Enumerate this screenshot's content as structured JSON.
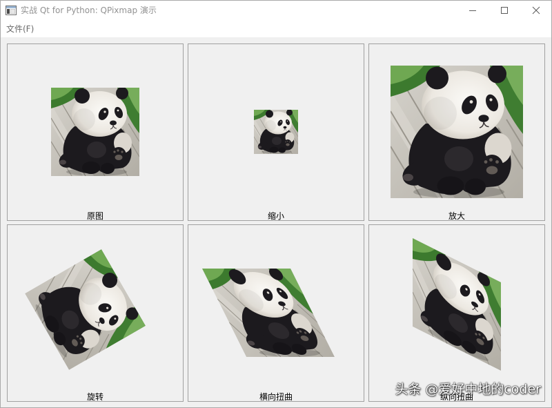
{
  "window": {
    "title": "实战 Qt for Python: QPixmap 演示",
    "icon": "qt-app-icon",
    "controls": {
      "minimize": "minimize-icon",
      "maximize": "maximize-icon",
      "close": "close-icon"
    }
  },
  "menubar": {
    "items": [
      {
        "label": "文件(F)"
      }
    ]
  },
  "panels": [
    {
      "caption": "原图"
    },
    {
      "caption": "缩小"
    },
    {
      "caption": "放大"
    },
    {
      "caption": "旋转"
    },
    {
      "caption": "横向扭曲"
    },
    {
      "caption": "纵向扭曲"
    }
  ],
  "watermark": {
    "text": "头条 @爱好中地的coder"
  }
}
